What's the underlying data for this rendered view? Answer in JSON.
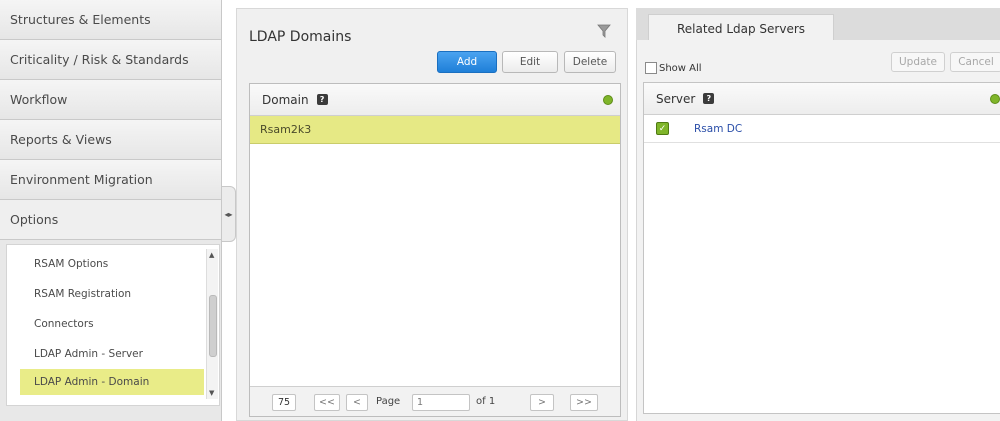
{
  "nav": {
    "sections": [
      "Structures & Elements",
      "Criticality / Risk & Standards",
      "Workflow",
      "Reports & Views",
      "Environment Migration",
      "Options"
    ],
    "sub_items": [
      "RSAM Options",
      "RSAM Registration",
      "Connectors",
      "LDAP Admin - Server",
      "LDAP Admin - Domain"
    ],
    "active_sub": "LDAP Admin - Domain"
  },
  "domains": {
    "title": "LDAP Domains",
    "add_label": "Add",
    "edit_label": "Edit",
    "delete_label": "Delete",
    "column_header": "Domain",
    "rows": [
      "Rsam2k3"
    ],
    "pager": {
      "page_size": "75",
      "first": "<<",
      "prev": "<",
      "page_label": "Page",
      "page_value": "1",
      "of_label": "of 1",
      "next": ">",
      "last": ">>"
    }
  },
  "related": {
    "tab_label": "Related Ldap Servers",
    "show_all_label": "Show All",
    "update_label": "Update",
    "cancel_label": "Cancel",
    "column_header": "Server",
    "rows": [
      "Rsam DC"
    ]
  },
  "colors": {
    "selected_row": "#e6e985",
    "primary_button": "#1f7fd8",
    "status_green": "#7fb52a",
    "link": "#2a4ea8"
  },
  "icons": [
    "filter-icon",
    "help-icon",
    "add-column-icon",
    "checkbox-icon",
    "collapse-handle-icon"
  ]
}
